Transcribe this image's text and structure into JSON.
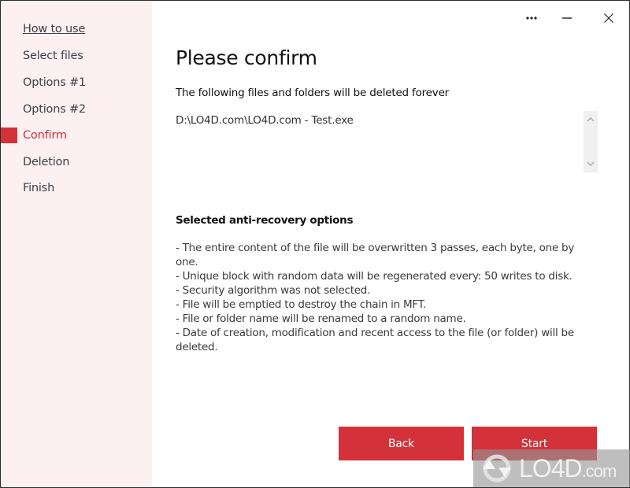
{
  "window": {
    "controls": {
      "more_icon": "more-options-icon",
      "minimize_icon": "minimize-icon",
      "close_icon": "close-icon"
    }
  },
  "sidebar": {
    "items": [
      {
        "label": "How to use",
        "state": "link"
      },
      {
        "label": "Select files",
        "state": "normal"
      },
      {
        "label": "Options #1",
        "state": "normal"
      },
      {
        "label": "Options #2",
        "state": "normal"
      },
      {
        "label": "Confirm",
        "state": "active"
      },
      {
        "label": "Deletion",
        "state": "normal"
      },
      {
        "label": "Finish",
        "state": "normal"
      }
    ],
    "active_color": "#d3323a",
    "background": "#fdf0f0"
  },
  "main": {
    "title": "Please confirm",
    "subtitle": "The following files and folders will be deleted forever",
    "files": [
      "D:\\LO4D.com\\LO4D.com - Test.exe"
    ],
    "options_title": "Selected anti-recovery options",
    "options": [
      "- The entire content of the file will be overwritten 3 passes, each byte, one by one.",
      "- Unique block with random data will be regenerated every: 50 writes to disk.",
      "- Security algorithm was not selected.",
      "- File will be emptied to destroy the chain in MFT.",
      "- File or folder name will be renamed to a random name.",
      "- Date of creation, modification and recent access to the file (or folder) will be deleted."
    ]
  },
  "buttons": {
    "back": "Back",
    "start": "Start",
    "color": "#d3323a"
  },
  "watermark": {
    "brand": "LO4D",
    "suffix": ".com"
  }
}
